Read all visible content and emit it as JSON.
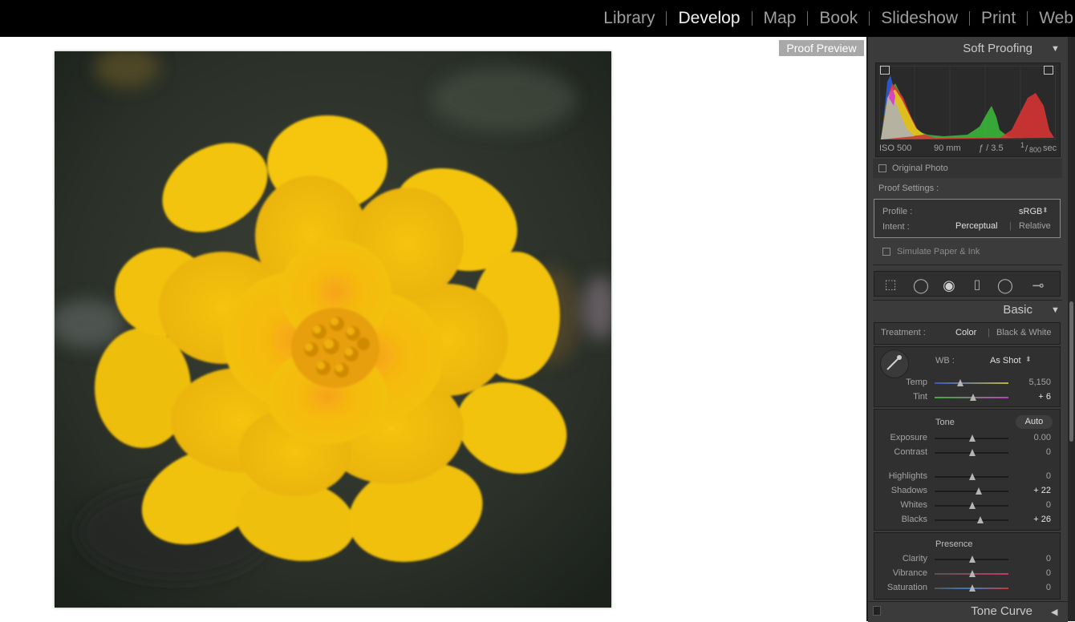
{
  "modules": [
    "Library",
    "Develop",
    "Map",
    "Book",
    "Slideshow",
    "Print",
    "Web"
  ],
  "active_module": "Develop",
  "preview": {
    "proof_label": "Proof Preview",
    "photo_subject": "yellow marigold flower"
  },
  "panels": {
    "soft_proofing": {
      "title": "Soft Proofing",
      "histogram_meta": {
        "iso": "ISO 500",
        "focal": "90 mm",
        "aperture": "ƒ / 3.5",
        "shutter_num": "1",
        "shutter_den": "800",
        "shutter_unit": "sec"
      },
      "original_photo": "Original Photo",
      "proof_settings": "Proof Settings :",
      "profile_label": "Profile :",
      "profile_value": "sRGB",
      "intent_label": "Intent :",
      "intent_options": [
        "Perceptual",
        "Relative"
      ],
      "simulate": "Simulate Paper & Ink"
    },
    "toolstrip": [
      "crop-overlay-icon",
      "spot-removal-icon",
      "red-eye-icon",
      "graduated-filter-icon",
      "radial-filter-icon",
      "adjustment-brush-icon"
    ],
    "basic": {
      "title": "Basic",
      "treatment_label": "Treatment :",
      "treatment_options": [
        "Color",
        "Black & White"
      ],
      "wb_label": "WB :",
      "wb_value": "As Shot",
      "temp": {
        "label": "Temp",
        "value": "5,150"
      },
      "tint": {
        "label": "Tint",
        "value": "+ 6"
      },
      "tone_label": "Tone",
      "auto_label": "Auto",
      "tone_sliders": [
        {
          "label": "Exposure",
          "value": "0.00"
        },
        {
          "label": "Contrast",
          "value": "0"
        },
        {
          "label": "Highlights",
          "value": "0"
        },
        {
          "label": "Shadows",
          "value": "+ 22"
        },
        {
          "label": "Whites",
          "value": "0"
        },
        {
          "label": "Blacks",
          "value": "+ 26"
        }
      ],
      "presence_label": "Presence",
      "presence_sliders": [
        {
          "label": "Clarity",
          "value": "0"
        },
        {
          "label": "Vibrance",
          "value": "0"
        },
        {
          "label": "Saturation",
          "value": "0"
        }
      ]
    },
    "tone_curve": {
      "title": "Tone Curve"
    }
  }
}
